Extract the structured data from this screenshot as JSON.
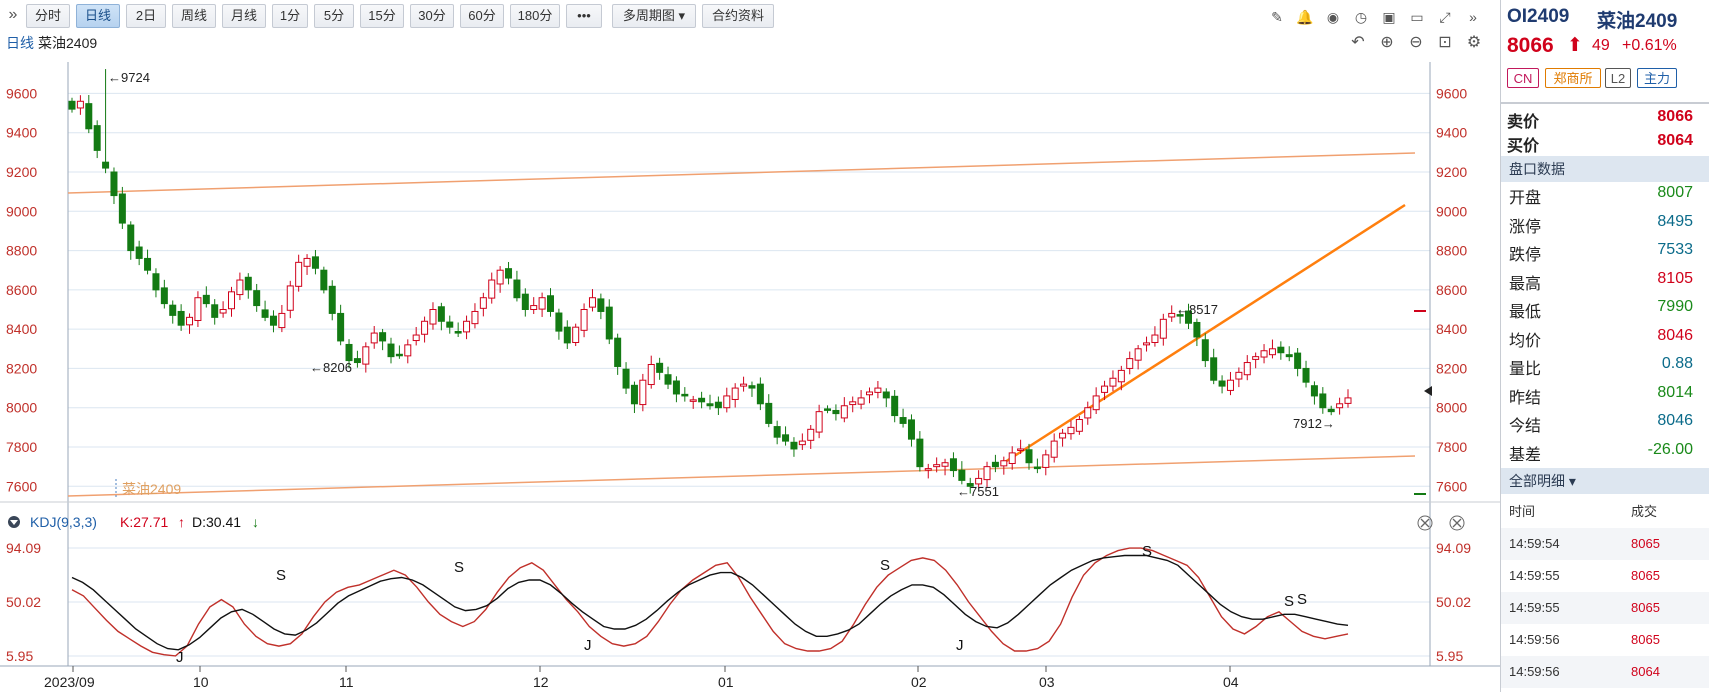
{
  "toolbar": {
    "collapse_icon": "double-chevron-right-icon",
    "buttons": [
      {
        "label": "分时",
        "active": false
      },
      {
        "label": "日线",
        "active": true
      },
      {
        "label": "2日",
        "active": false
      },
      {
        "label": "周线",
        "active": false
      },
      {
        "label": "月线",
        "active": false
      },
      {
        "label": "1分",
        "active": false
      },
      {
        "label": "5分",
        "active": false
      },
      {
        "label": "15分",
        "active": false
      },
      {
        "label": "30分",
        "active": false
      },
      {
        "label": "60分",
        "active": false
      },
      {
        "label": "180分",
        "active": false
      },
      {
        "label": "•••",
        "active": false
      },
      {
        "label": "多周期图 ▾",
        "active": false
      },
      {
        "label": "合约资料",
        "active": false
      }
    ],
    "right_icons": [
      "draw-pen-icon",
      "bell-icon",
      "eye-icon",
      "clock-icon",
      "camera-icon",
      "monitor-icon",
      "fullscreen-icon",
      "double-chevron-right-icon"
    ],
    "chart_icons": [
      "undo-icon",
      "zoom-in-icon",
      "zoom-out-icon",
      "layout-icon",
      "settings-icon"
    ]
  },
  "main": {
    "period_label": "日线",
    "symbol_label": "菜油2409",
    "watermark": "菜油2409",
    "indicator": {
      "name": "KDJ(9,3,3)",
      "k_label": "K:27.71",
      "d_label": "D:30.41",
      "close_icon": "close-icon"
    },
    "annotations": {
      "high_label": "←9724",
      "low1_label": "←8206",
      "low2_label": "←7551",
      "high2_label": "←8517",
      "low3_label": "7912→"
    }
  },
  "chart_data": {
    "type": "candlestick",
    "price_ylim": [
      7520,
      9760
    ],
    "price_ticks": [
      9600,
      9400,
      9200,
      9000,
      8800,
      8600,
      8400,
      8200,
      8000,
      7800,
      7600
    ],
    "kdj_ylim": [
      5.95,
      94.09
    ],
    "kdj_ticks": [
      "94.09",
      "50.02",
      "5.95"
    ],
    "x_labels": [
      "2023/09",
      "10",
      "11",
      "12",
      "01",
      "02",
      "03",
      "04"
    ],
    "closes": [
      9520,
      9560,
      9420,
      9310,
      9220,
      9080,
      8940,
      8800,
      8760,
      8700,
      8600,
      8530,
      8470,
      8420,
      8460,
      8560,
      8530,
      8460,
      8500,
      8590,
      8650,
      8600,
      8520,
      8460,
      8420,
      8480,
      8620,
      8740,
      8760,
      8710,
      8600,
      8480,
      8340,
      8240,
      8230,
      8310,
      8380,
      8340,
      8260,
      8270,
      8320,
      8370,
      8440,
      8500,
      8440,
      8410,
      8380,
      8440,
      8490,
      8560,
      8650,
      8700,
      8660,
      8560,
      8500,
      8520,
      8560,
      8490,
      8390,
      8330,
      8410,
      8500,
      8560,
      8490,
      8350,
      8210,
      8100,
      8020,
      8140,
      8220,
      8180,
      8120,
      8070,
      8060,
      8040,
      8030,
      8010,
      8000,
      8060,
      8100,
      8120,
      8100,
      8020,
      7920,
      7850,
      7830,
      7790,
      7830,
      7890,
      7980,
      7990,
      7970,
      8010,
      8030,
      8050,
      8080,
      8100,
      8050,
      7960,
      7920,
      7840,
      7700,
      7690,
      7710,
      7720,
      7680,
      7630,
      7600,
      7640,
      7700,
      7700,
      7730,
      7770,
      7790,
      7720,
      7690,
      7760,
      7830,
      7870,
      7900,
      7940,
      8000,
      8060,
      8110,
      8150,
      8190,
      8250,
      8300,
      8330,
      8370,
      8450,
      8480,
      8470,
      8430,
      8360,
      8240,
      8140,
      8110,
      8140,
      8180,
      8230,
      8260,
      8290,
      8300,
      8280,
      8260,
      8200,
      8130,
      8060,
      8000,
      7980,
      8020,
      8050
    ],
    "kdj_k": [
      60,
      55,
      45,
      35,
      26,
      20,
      14,
      9,
      7,
      6,
      14,
      32,
      46,
      52,
      46,
      32,
      22,
      16,
      14,
      16,
      24,
      38,
      50,
      58,
      62,
      64,
      68,
      72,
      76,
      72,
      62,
      50,
      40,
      34,
      30,
      34,
      44,
      58,
      70,
      78,
      82,
      76,
      64,
      52,
      42,
      30,
      22,
      16,
      14,
      16,
      22,
      34,
      48,
      60,
      68,
      74,
      80,
      82,
      70,
      54,
      40,
      26,
      16,
      12,
      10,
      10,
      12,
      18,
      32,
      48,
      62,
      72,
      78,
      84,
      86,
      84,
      76,
      64,
      50,
      38,
      26,
      16,
      10,
      10,
      12,
      18,
      32,
      54,
      72,
      82,
      88,
      92,
      94,
      94,
      92,
      88,
      84,
      80,
      70,
      54,
      38,
      28,
      24,
      30,
      38,
      42,
      34,
      26,
      22,
      20,
      22,
      24
    ],
    "kdj_d": [
      70,
      66,
      60,
      52,
      44,
      36,
      28,
      22,
      16,
      12,
      11,
      15,
      21,
      29,
      37,
      42,
      44,
      40,
      34,
      28,
      24,
      23,
      27,
      33,
      41,
      49,
      55,
      59,
      63,
      67,
      69,
      70,
      68,
      64,
      58,
      52,
      46,
      43,
      44,
      47,
      53,
      61,
      66,
      68,
      68,
      64,
      57,
      49,
      42,
      36,
      30,
      28,
      28,
      31,
      36,
      43,
      51,
      58,
      64,
      68,
      72,
      74,
      74,
      70,
      64,
      56,
      48,
      40,
      32,
      26,
      22,
      22,
      24,
      27,
      32,
      40,
      48,
      55,
      60,
      64,
      64,
      62,
      56,
      48,
      40,
      34,
      30,
      29,
      33,
      40,
      48,
      56,
      64,
      70,
      76,
      80,
      84,
      86,
      87,
      88,
      88,
      88,
      86,
      84,
      80,
      72,
      64,
      56,
      48,
      42,
      38,
      36,
      36,
      38,
      40,
      40,
      38,
      36,
      34,
      32,
      31
    ]
  },
  "quote": {
    "code": "OI2409",
    "name": "菜油2409",
    "price": "8066",
    "change": "49",
    "change_pct": "+0.61%",
    "tags": [
      {
        "label": "CN",
        "color": "#c2185b"
      },
      {
        "label": "郑商所",
        "color": "#e07b00"
      },
      {
        "label": "L2",
        "color": "#555"
      },
      {
        "label": "主力",
        "color": "#1f5fa8"
      }
    ],
    "sell_label": "卖价",
    "sell_value": "8066",
    "buy_label": "买价",
    "buy_value": "8064",
    "section_title": "盘口数据",
    "rows": [
      {
        "label": "开盘",
        "value": "8007",
        "color": "#1a8a1a"
      },
      {
        "label": "涨停",
        "value": "8495",
        "color": "#0b6b8a"
      },
      {
        "label": "跌停",
        "value": "7533",
        "color": "#0b6b8a"
      },
      {
        "label": "最高",
        "value": "8105",
        "color": "#d0021b"
      },
      {
        "label": "最低",
        "value": "7990",
        "color": "#1a8a1a"
      },
      {
        "label": "均价",
        "value": "8046",
        "color": "#d0021b"
      },
      {
        "label": "量比",
        "value": "0.88",
        "color": "#0b6b8a"
      },
      {
        "label": "昨结",
        "value": "8014",
        "color": "#1a8a1a"
      },
      {
        "label": "今结",
        "value": "8046",
        "color": "#0b6b8a"
      },
      {
        "label": "基差",
        "value": "-26.00",
        "color": "#1a8a1a"
      }
    ],
    "detail_title": "全部明细 ▾",
    "trade_header_time": "时间",
    "trade_header_price": "成交",
    "trades": [
      {
        "time": "14:59:54",
        "price": "8065"
      },
      {
        "time": "14:59:55",
        "price": "8065"
      },
      {
        "time": "14:59:55",
        "price": "8065"
      },
      {
        "time": "14:59:56",
        "price": "8065"
      },
      {
        "time": "14:59:56",
        "price": "8064"
      }
    ]
  },
  "colors": {
    "up": "#d0021b",
    "down": "#137a13",
    "trend": "#ff7f0e",
    "channel": "#f0a070",
    "grid": "#dbe6f0",
    "axis_label": "#c0302a"
  }
}
